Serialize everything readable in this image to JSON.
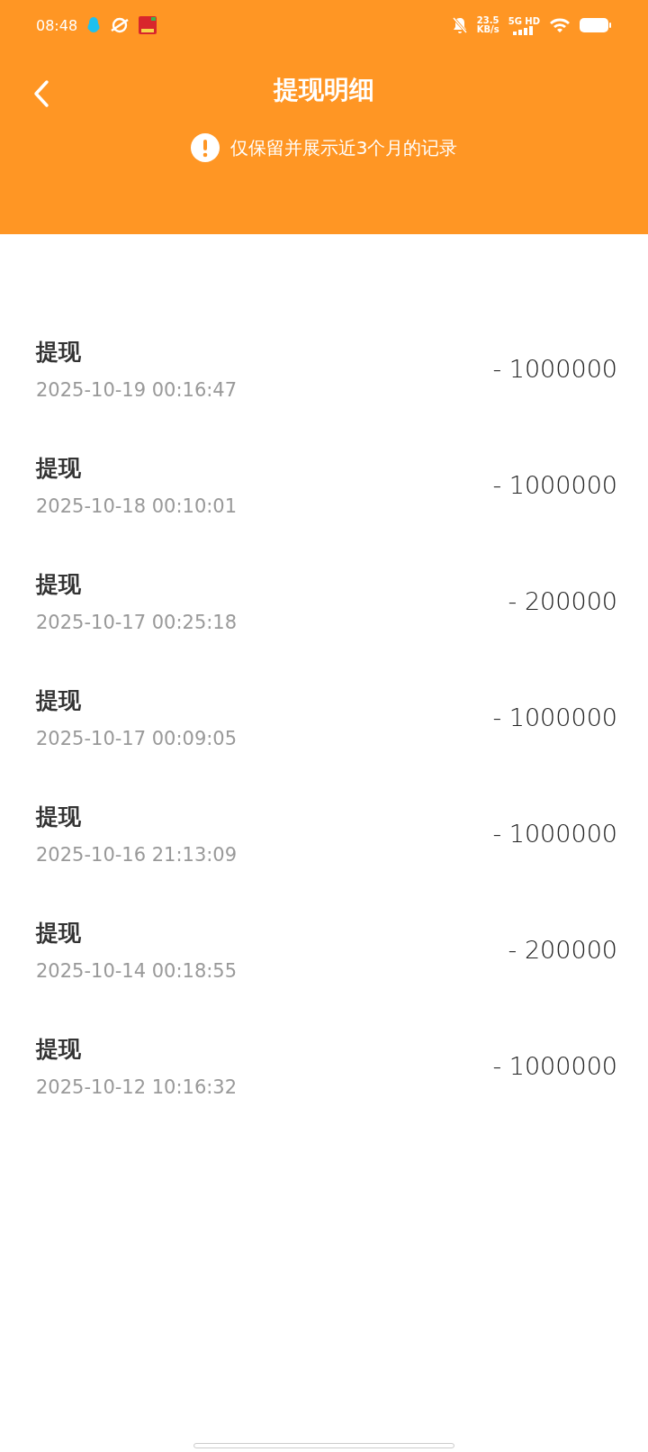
{
  "status_bar": {
    "time": "08:48",
    "net_speed": "23.5",
    "net_unit": "KB/s",
    "network": "5G HD"
  },
  "header": {
    "title": "提现明细",
    "notice": "仅保留并展示近3个月的记录"
  },
  "records": [
    {
      "title": "提现",
      "time": "2025-10-19 00:16:47",
      "amount": "- 1000000"
    },
    {
      "title": "提现",
      "time": "2025-10-18 00:10:01",
      "amount": "- 1000000"
    },
    {
      "title": "提现",
      "time": "2025-10-17 00:25:18",
      "amount": "- 200000"
    },
    {
      "title": "提现",
      "time": "2025-10-17 00:09:05",
      "amount": "- 1000000"
    },
    {
      "title": "提现",
      "time": "2025-10-16 21:13:09",
      "amount": "- 1000000"
    },
    {
      "title": "提现",
      "time": "2025-10-14 00:18:55",
      "amount": "- 200000"
    },
    {
      "title": "提现",
      "time": "2025-10-12 10:16:32",
      "amount": "- 1000000"
    }
  ]
}
